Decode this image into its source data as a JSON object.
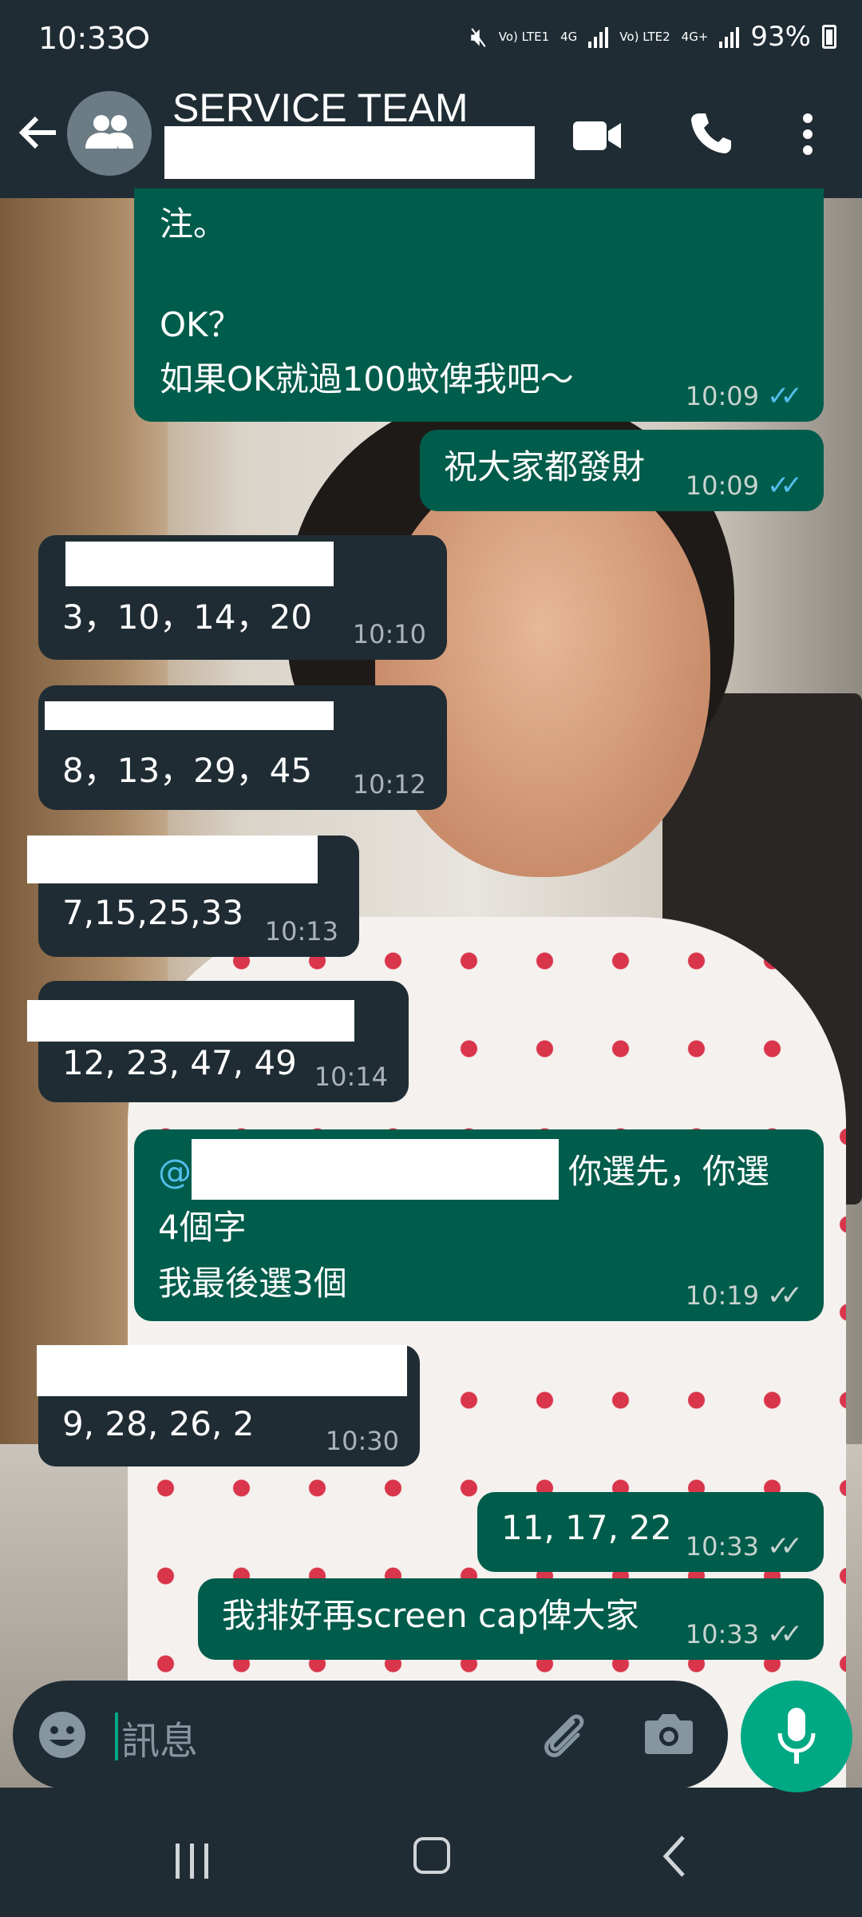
{
  "status_bar": {
    "time": "10:33",
    "sim1_label": "Vo) LTE1",
    "sim1_net": "4G",
    "sim2_label": "Vo) LTE2",
    "sim2_net": "4G+",
    "battery": "93%"
  },
  "header": {
    "title": "SERVICE TEAM"
  },
  "messages": [
    {
      "direction": "out",
      "lines": [
        "注。",
        "",
        "OK？",
        "如果OK就過100蚊俾我吧～"
      ],
      "time": "10:09",
      "status": "read"
    },
    {
      "direction": "out",
      "lines": [
        "祝大家都發財"
      ],
      "time": "10:09",
      "status": "read"
    },
    {
      "direction": "in",
      "lines": [
        "3，10，14，20"
      ],
      "time": "10:10"
    },
    {
      "direction": "in",
      "lines": [
        "8，13，29，45"
      ],
      "time": "10:12"
    },
    {
      "direction": "in",
      "lines": [
        "7,15,25,33"
      ],
      "time": "10:13"
    },
    {
      "direction": "in",
      "lines": [
        "12, 23, 47, 49"
      ],
      "time": "10:14"
    },
    {
      "direction": "out",
      "mention": "@",
      "lines": [
        "你選先，你選",
        "4個字",
        "我最後選3個"
      ],
      "time": "10:19",
      "status": "delivered"
    },
    {
      "direction": "in",
      "lines": [
        "9, 28, 26, 2"
      ],
      "time": "10:30"
    },
    {
      "direction": "out",
      "lines": [
        "11, 17, 22"
      ],
      "time": "10:33",
      "status": "delivered"
    },
    {
      "direction": "out",
      "lines": [
        "我排好再screen cap俾大家"
      ],
      "time": "10:33",
      "status": "delivered"
    }
  ],
  "composer": {
    "placeholder": "訊息"
  },
  "colors": {
    "outgoing_bubble": "#005c4b",
    "incoming_bubble": "#1f2c34",
    "accent": "#00a884",
    "read_tick": "#53bdeb"
  },
  "icons": [
    "back-arrow-icon",
    "group-avatar-icon",
    "video-call-icon",
    "voice-call-icon",
    "more-options-icon",
    "emoji-icon",
    "attach-icon",
    "camera-icon",
    "mic-icon",
    "recent-apps-icon",
    "home-icon",
    "back-nav-icon"
  ]
}
